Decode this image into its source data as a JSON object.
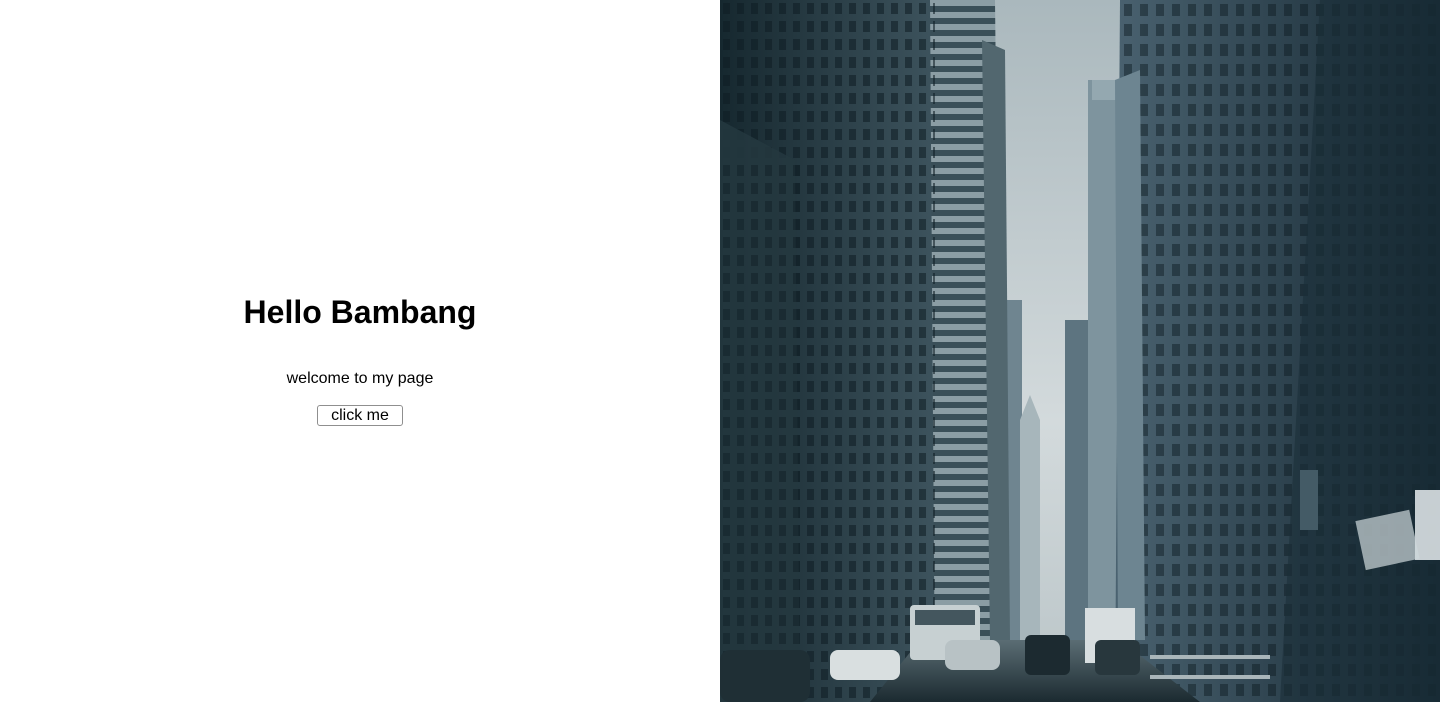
{
  "main": {
    "title": "Hello Bambang",
    "subtitle": "welcome to my page",
    "button_label": "click me"
  },
  "hero_image": {
    "subject": "city-street-skyscrapers-photo",
    "colors": {
      "sky": "#c9d1d4",
      "building_dark": "#1f333c",
      "building_mid": "#3e5560",
      "building_light": "#6f8791",
      "street": "#2b3a41"
    }
  }
}
